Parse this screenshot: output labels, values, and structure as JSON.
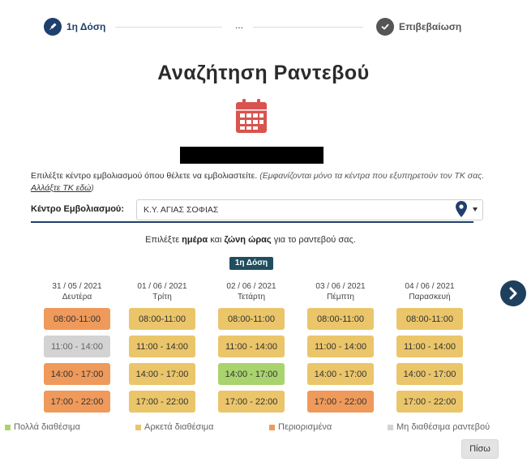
{
  "stepper": {
    "step1_label": "1η Δόση",
    "dots": "...",
    "step2_label": "Επιβεβαίωση"
  },
  "title": "Αναζήτηση Ραντεβού",
  "instructions": {
    "main": "Επιλέξτε κέντρο εμβολιασμού όπου θέλετε να εμβολιαστείτε. ",
    "note": "(Εμφανίζονται μόνο τα κέντρα που εξυπηρετούν τον ΤΚ σας. ",
    "link": "Αλλάξτε ΤΚ εδώ",
    "note_end": ")"
  },
  "center": {
    "label": "Κέντρο Εμβολιασμού:",
    "selected": "Κ.Υ. ΑΓΙΑΣ ΣΟΦΙΑΣ"
  },
  "prompt": {
    "pre": "Επιλέξτε ",
    "day": "ημέρα",
    "mid": " και ",
    "zone": "ζώνη ώρας",
    "post": " για το ραντεβού σας."
  },
  "dose_badge": "1η Δόση",
  "days": [
    {
      "date": "31 / 05 / 2021",
      "name": "Δευτέρα",
      "slots": [
        {
          "time": "08:00-11:00",
          "status": "limited"
        },
        {
          "time": "11:00 - 14:00",
          "status": "none"
        },
        {
          "time": "14:00 - 17:00",
          "status": "limited"
        },
        {
          "time": "17:00 - 22:00",
          "status": "limited"
        }
      ]
    },
    {
      "date": "01 / 06 / 2021",
      "name": "Τρίτη",
      "slots": [
        {
          "time": "08:00-11:00",
          "status": "enough"
        },
        {
          "time": "11:00 - 14:00",
          "status": "enough"
        },
        {
          "time": "14:00 - 17:00",
          "status": "enough"
        },
        {
          "time": "17:00 - 22:00",
          "status": "enough"
        }
      ]
    },
    {
      "date": "02 / 06 / 2021",
      "name": "Τετάρτη",
      "slots": [
        {
          "time": "08:00-11:00",
          "status": "enough"
        },
        {
          "time": "11:00 - 14:00",
          "status": "enough"
        },
        {
          "time": "14:00 - 17:00",
          "status": "many"
        },
        {
          "time": "17:00 - 22:00",
          "status": "enough"
        }
      ]
    },
    {
      "date": "03 / 06 / 2021",
      "name": "Πέμπτη",
      "slots": [
        {
          "time": "08:00-11:00",
          "status": "enough"
        },
        {
          "time": "11:00 - 14:00",
          "status": "enough"
        },
        {
          "time": "14:00 - 17:00",
          "status": "enough"
        },
        {
          "time": "17:00 - 22:00",
          "status": "limited"
        }
      ]
    },
    {
      "date": "04 / 06 / 2021",
      "name": "Παρασκευή",
      "slots": [
        {
          "time": "08:00-11:00",
          "status": "enough"
        },
        {
          "time": "11:00 - 14:00",
          "status": "enough"
        },
        {
          "time": "14:00 - 17:00",
          "status": "enough"
        },
        {
          "time": "17:00 - 22:00",
          "status": "enough"
        }
      ]
    }
  ],
  "legend": {
    "many": "Πολλά διαθέσιμα",
    "enough": "Αρκετά διαθέσιμα",
    "limited": "Περιορισμένα",
    "none": "Μη διαθέσιμα ραντεβού"
  },
  "colors": {
    "primary": "#1f3f6e",
    "many": "#a9d36c",
    "enough": "#eac56a",
    "limited": "#ef9a5b",
    "none": "#d3d3d3",
    "calendar_red": "#d9534f"
  },
  "icons": {
    "step1": "syringe-icon",
    "step2": "check-circle-icon",
    "calendar": "calendar-icon",
    "pin": "map-pin-icon",
    "next": "chevron-right-icon"
  },
  "back_label": "Πίσω"
}
